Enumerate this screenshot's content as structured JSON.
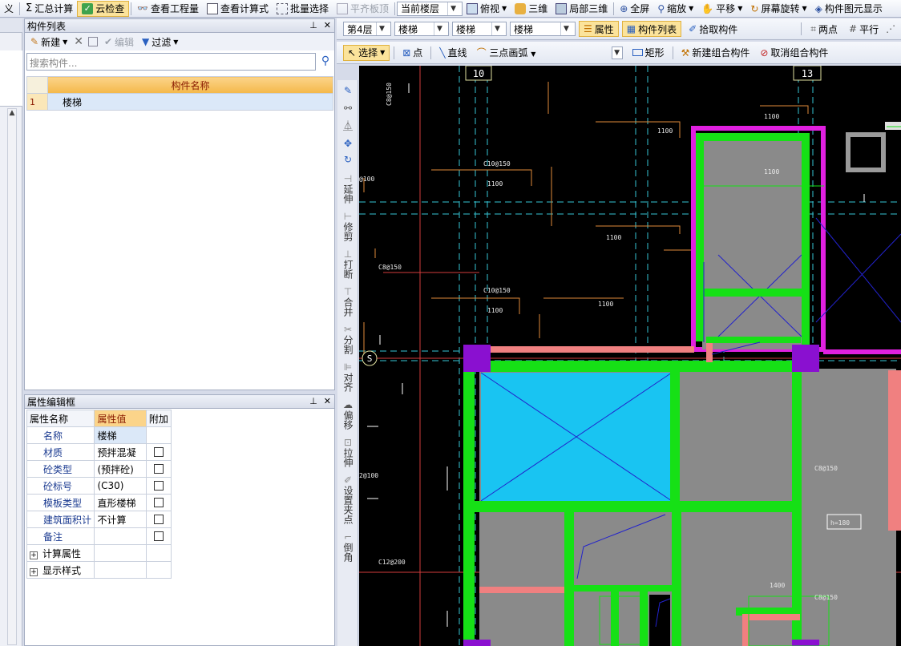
{
  "toolbar_main": {
    "partial_left": "义",
    "summary_calc": "汇总计算",
    "cloud_check": "云检查",
    "view_quantity": "查看工程量",
    "view_formula": "查看计算式",
    "batch_select": "批量选择",
    "flat_slab": "平齐板顶",
    "current_floor": "当前楼层",
    "top_view": "俯视",
    "three_d": "三维",
    "local_3d": "局部三维",
    "fullscreen": "全屏",
    "zoom": "缩放",
    "pan": "平移",
    "screen_rotate": "屏幕旋转",
    "component_display": "构件图元显示"
  },
  "toolbar_second": {
    "floor": "第4层",
    "category1": "楼梯",
    "category2": "楼梯",
    "category3": "楼梯",
    "properties": "属性",
    "component_list": "构件列表",
    "pick_component": "拾取构件",
    "two_points": "两点",
    "parallel": "平行"
  },
  "toolbar_draw": {
    "select": "选择",
    "point": "点",
    "line": "直线",
    "arc3": "三点画弧",
    "rect": "矩形",
    "new_combo": "新建组合构件",
    "cancel_combo": "取消组合构件"
  },
  "component_list": {
    "title": "构件列表",
    "new": "新建",
    "edit": "编辑",
    "filter": "过滤",
    "search_placeholder": "搜索构件...",
    "column_header": "构件名称",
    "rows": [
      {
        "index": "1",
        "name": "楼梯"
      }
    ]
  },
  "property_editor": {
    "title": "属性编辑框",
    "headers": {
      "name": "属性名称",
      "value": "属性值",
      "extra": "附加"
    },
    "rows": [
      {
        "name": "名称",
        "value": "楼梯",
        "checkbox": false
      },
      {
        "name": "材质",
        "value": "预拌混凝",
        "checkbox": true
      },
      {
        "name": "砼类型",
        "value": "(预拌砼)",
        "checkbox": true
      },
      {
        "name": "砼标号",
        "value": "(C30)",
        "checkbox": true
      },
      {
        "name": "模板类型",
        "value": "直形楼梯",
        "checkbox": true
      },
      {
        "name": "建筑面积计",
        "value": "不计算",
        "checkbox": true
      },
      {
        "name": "备注",
        "value": "",
        "checkbox": true
      },
      {
        "name": "计算属性",
        "value": "",
        "checkbox": false
      },
      {
        "name": "显示样式",
        "value": "",
        "checkbox": false
      }
    ]
  },
  "vertical_tools": [
    "延伸",
    "修剪",
    "打断",
    "合并",
    "分割",
    "对齐",
    "偏移",
    "拉伸",
    "设置夹点",
    "倒角"
  ],
  "canvas_labels": {
    "axis_10": "10",
    "axis_13": "13",
    "axis_s": "S",
    "dims": [
      "1100",
      "1100",
      "1100",
      "1100",
      "1100",
      "1100",
      "1100",
      "1400"
    ],
    "rebar": [
      "C8@150",
      "C10@150",
      "C8@150",
      "C8@150",
      "C10@150",
      "C8@150",
      "C12@200",
      "2@100",
      "@100"
    ],
    "h_label": "h=180"
  }
}
